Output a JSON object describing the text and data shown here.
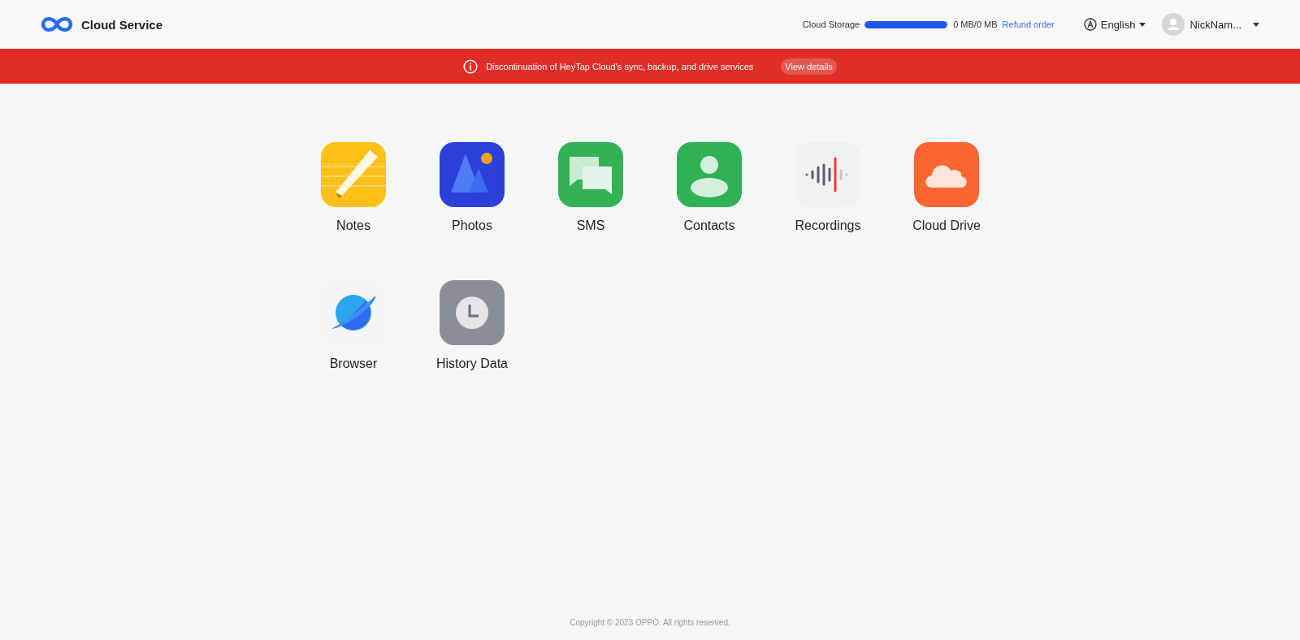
{
  "header": {
    "brand": "Cloud Service",
    "storage": {
      "label": "Cloud Storage",
      "level": 1,
      "reading": "0 MB/0 MB"
    },
    "refund_link": "Refund order",
    "language": "English",
    "user": "NickNam..."
  },
  "notice": {
    "text": "Discontinuation of HeyTap Cloud's sync, backup, and drive services",
    "button": "View details"
  },
  "apps": [
    {
      "kind": "notes",
      "label": "Notes"
    },
    {
      "kind": "photos",
      "label": "Photos"
    },
    {
      "kind": "sms",
      "label": "SMS"
    },
    {
      "kind": "contacts",
      "label": "Contacts"
    },
    {
      "kind": "recordings",
      "label": "Recordings"
    },
    {
      "kind": "drive",
      "label": "Cloud Drive"
    },
    {
      "kind": "browser",
      "label": "Browser"
    },
    {
      "kind": "history",
      "label": "History Data"
    }
  ],
  "footer": "Copyright © 2023 OPPO. All rights reserved."
}
